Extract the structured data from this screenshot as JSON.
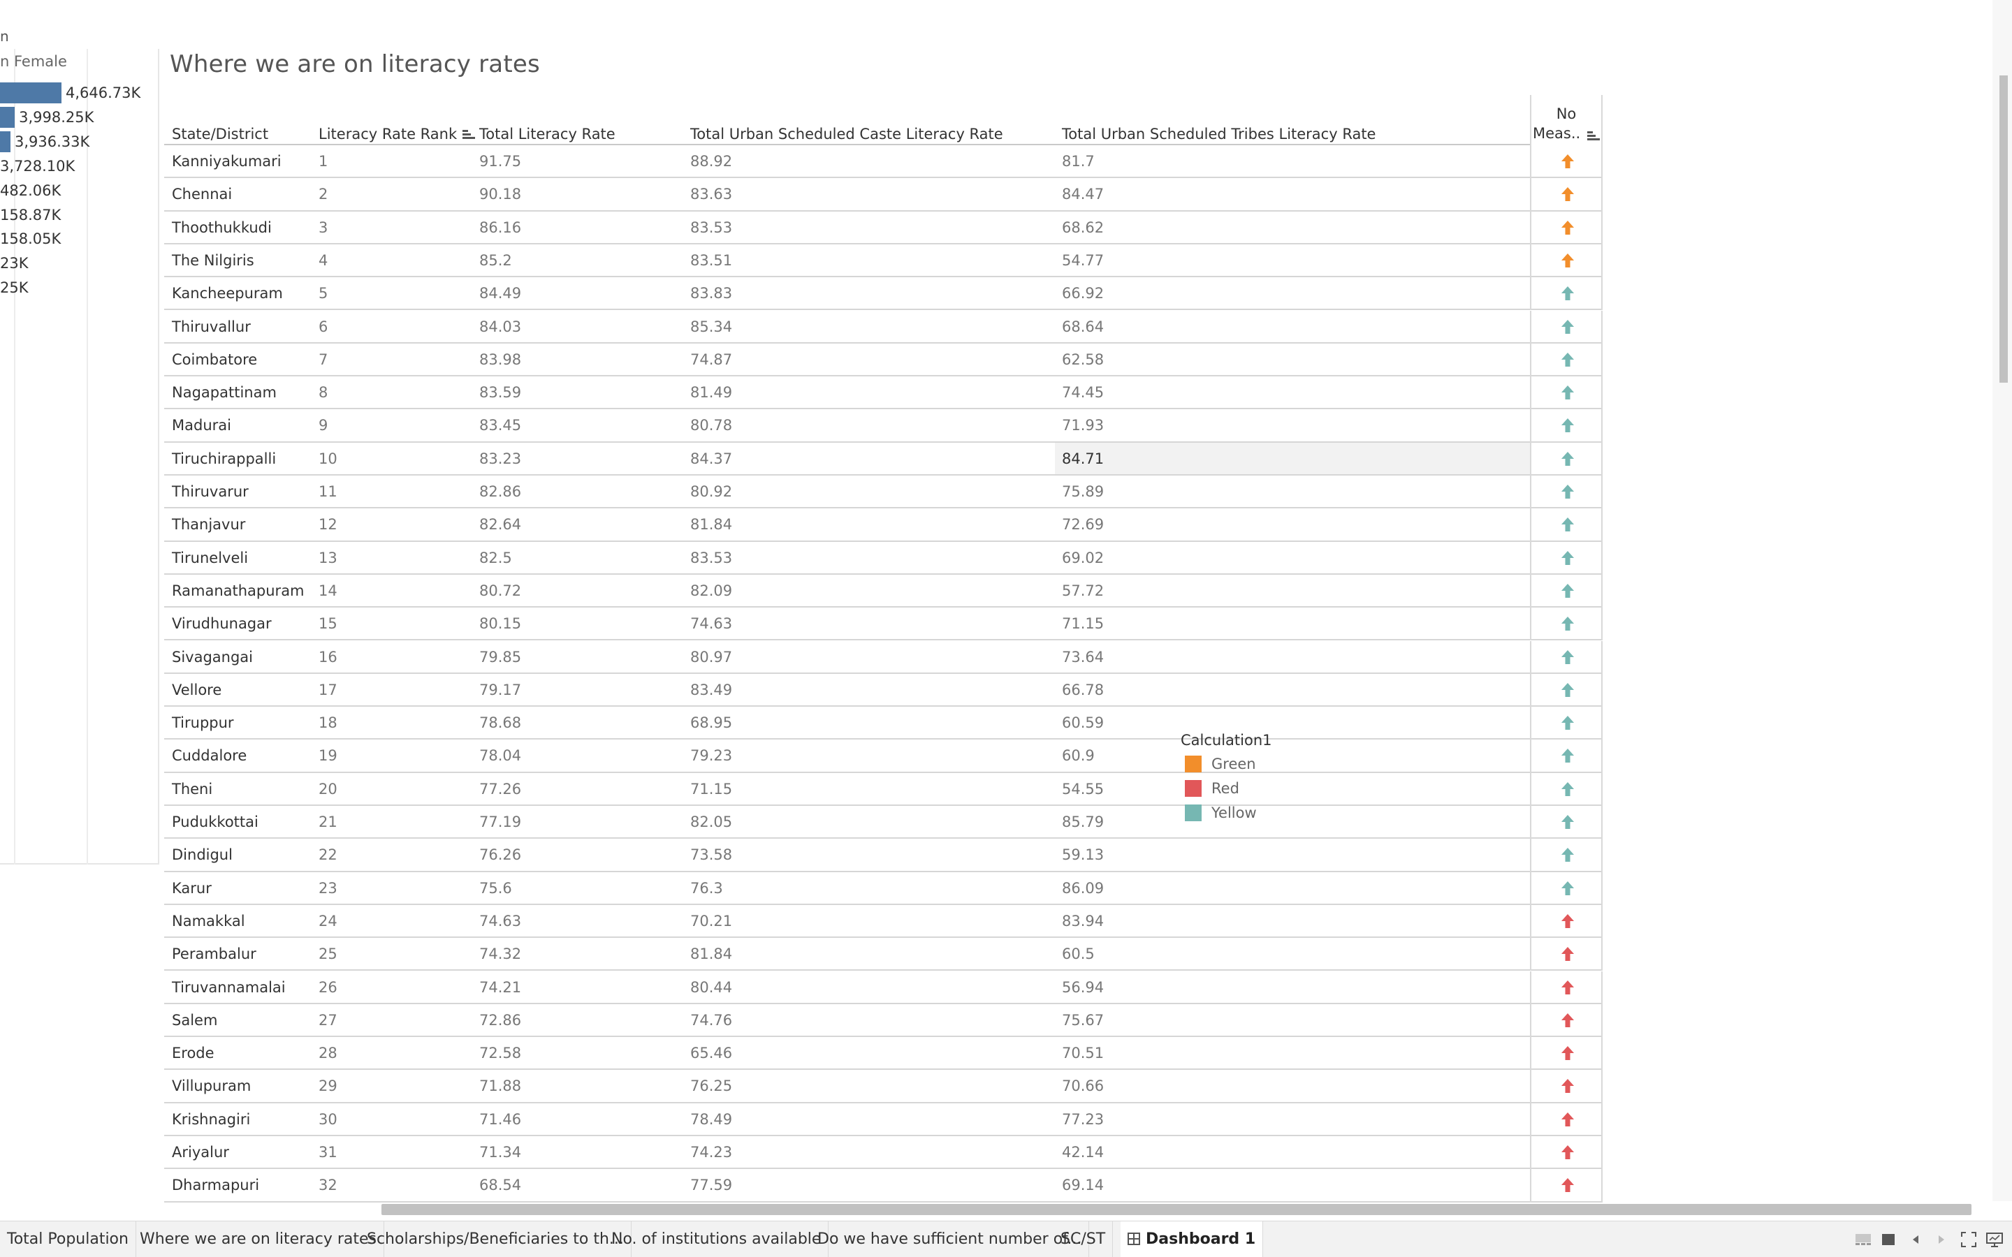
{
  "left_panel": {
    "truncated_title": "n",
    "column_label": "n Female",
    "rows": [
      {
        "label": "4,646.73K",
        "bar_fraction": 1.0
      },
      {
        "label": "3,998.25K",
        "bar_fraction": 0.24
      },
      {
        "label": "3,936.33K",
        "bar_fraction": 0.17
      },
      {
        "label": "3,728.10K",
        "bar_fraction": 0
      },
      {
        "label": "482.06K",
        "bar_fraction": 0
      },
      {
        "label": "158.87K",
        "bar_fraction": 0
      },
      {
        "label": "158.05K",
        "bar_fraction": 0
      },
      {
        "label": "23K",
        "bar_fraction": 0
      },
      {
        "label": "25K",
        "bar_fraction": 0
      }
    ]
  },
  "sheet": {
    "title": "Where we are on literacy rates",
    "columns": {
      "state": "State/District",
      "rank": "Literacy Rate Rank",
      "total": "Total Literacy Rate",
      "sc": "Total Urban Scheduled Caste Literacy Rate",
      "st": "Total Urban Scheduled Tribes Literacy Rate",
      "no_measure_line1": "No",
      "no_measure_line2": "Meas.."
    },
    "rows": [
      {
        "name": "Kanniyakumari",
        "rank": "1",
        "total": "91.75",
        "sc": "88.92",
        "st": "81.7",
        "flag": "Green"
      },
      {
        "name": "Chennai",
        "rank": "2",
        "total": "90.18",
        "sc": "83.63",
        "st": "84.47",
        "flag": "Green"
      },
      {
        "name": "Thoothukkudi",
        "rank": "3",
        "total": "86.16",
        "sc": "83.53",
        "st": "68.62",
        "flag": "Green"
      },
      {
        "name": "The Nilgiris",
        "rank": "4",
        "total": "85.2",
        "sc": "83.51",
        "st": "54.77",
        "flag": "Green"
      },
      {
        "name": "Kancheepuram",
        "rank": "5",
        "total": "84.49",
        "sc": "83.83",
        "st": "66.92",
        "flag": "Yellow"
      },
      {
        "name": "Thiruvallur",
        "rank": "6",
        "total": "84.03",
        "sc": "85.34",
        "st": "68.64",
        "flag": "Yellow"
      },
      {
        "name": "Coimbatore",
        "rank": "7",
        "total": "83.98",
        "sc": "74.87",
        "st": "62.58",
        "flag": "Yellow"
      },
      {
        "name": "Nagapattinam",
        "rank": "8",
        "total": "83.59",
        "sc": "81.49",
        "st": "74.45",
        "flag": "Yellow"
      },
      {
        "name": "Madurai",
        "rank": "9",
        "total": "83.45",
        "sc": "80.78",
        "st": "71.93",
        "flag": "Yellow"
      },
      {
        "name": "Tiruchirappalli",
        "rank": "10",
        "total": "83.23",
        "sc": "84.37",
        "st": "84.71",
        "flag": "Yellow",
        "highlight": true
      },
      {
        "name": "Thiruvarur",
        "rank": "11",
        "total": "82.86",
        "sc": "80.92",
        "st": "75.89",
        "flag": "Yellow"
      },
      {
        "name": "Thanjavur",
        "rank": "12",
        "total": "82.64",
        "sc": "81.84",
        "st": "72.69",
        "flag": "Yellow"
      },
      {
        "name": "Tirunelveli",
        "rank": "13",
        "total": "82.5",
        "sc": "83.53",
        "st": "69.02",
        "flag": "Yellow"
      },
      {
        "name": "Ramanathapuram",
        "rank": "14",
        "total": "80.72",
        "sc": "82.09",
        "st": "57.72",
        "flag": "Yellow"
      },
      {
        "name": "Virudhunagar",
        "rank": "15",
        "total": "80.15",
        "sc": "74.63",
        "st": "71.15",
        "flag": "Yellow"
      },
      {
        "name": "Sivagangai",
        "rank": "16",
        "total": "79.85",
        "sc": "80.97",
        "st": "73.64",
        "flag": "Yellow"
      },
      {
        "name": "Vellore",
        "rank": "17",
        "total": "79.17",
        "sc": "83.49",
        "st": "66.78",
        "flag": "Yellow"
      },
      {
        "name": "Tiruppur",
        "rank": "18",
        "total": "78.68",
        "sc": "68.95",
        "st": "60.59",
        "flag": "Yellow"
      },
      {
        "name": "Cuddalore",
        "rank": "19",
        "total": "78.04",
        "sc": "79.23",
        "st": "60.9",
        "flag": "Yellow"
      },
      {
        "name": "Theni",
        "rank": "20",
        "total": "77.26",
        "sc": "71.15",
        "st": "54.55",
        "flag": "Yellow"
      },
      {
        "name": "Pudukkottai",
        "rank": "21",
        "total": "77.19",
        "sc": "82.05",
        "st": "85.79",
        "flag": "Yellow"
      },
      {
        "name": "Dindigul",
        "rank": "22",
        "total": "76.26",
        "sc": "73.58",
        "st": "59.13",
        "flag": "Yellow"
      },
      {
        "name": "Karur",
        "rank": "23",
        "total": "75.6",
        "sc": "76.3",
        "st": "86.09",
        "flag": "Yellow"
      },
      {
        "name": "Namakkal",
        "rank": "24",
        "total": "74.63",
        "sc": "70.21",
        "st": "83.94",
        "flag": "Red"
      },
      {
        "name": "Perambalur",
        "rank": "25",
        "total": "74.32",
        "sc": "81.84",
        "st": "60.5",
        "flag": "Red"
      },
      {
        "name": "Tiruvannamalai",
        "rank": "26",
        "total": "74.21",
        "sc": "80.44",
        "st": "56.94",
        "flag": "Red"
      },
      {
        "name": "Salem",
        "rank": "27",
        "total": "72.86",
        "sc": "74.76",
        "st": "75.67",
        "flag": "Red"
      },
      {
        "name": "Erode",
        "rank": "28",
        "total": "72.58",
        "sc": "65.46",
        "st": "70.51",
        "flag": "Red"
      },
      {
        "name": "Villupuram",
        "rank": "29",
        "total": "71.88",
        "sc": "76.25",
        "st": "70.66",
        "flag": "Red"
      },
      {
        "name": "Krishnagiri",
        "rank": "30",
        "total": "71.46",
        "sc": "78.49",
        "st": "77.23",
        "flag": "Red"
      },
      {
        "name": "Ariyalur",
        "rank": "31",
        "total": "71.34",
        "sc": "74.23",
        "st": "42.14",
        "flag": "Red"
      },
      {
        "name": "Dharmapuri",
        "rank": "32",
        "total": "68.54",
        "sc": "77.59",
        "st": "69.14",
        "flag": "Red"
      }
    ]
  },
  "legend": {
    "title": "Calculation1",
    "items": [
      {
        "label": "Green",
        "color": "#f28e2b"
      },
      {
        "label": "Red",
        "color": "#e15759"
      },
      {
        "label": "Yellow",
        "color": "#76b7b2"
      }
    ]
  },
  "colors": {
    "Green": "#f28e2b",
    "Red": "#e15759",
    "Yellow": "#76b7b2",
    "bar": "#4e79a7"
  },
  "tabs": [
    {
      "label": "Total Population",
      "active": false
    },
    {
      "label": "Where we are on literacy rates",
      "active": false
    },
    {
      "label": "Scholarships/Beneficiaries to th...",
      "active": false
    },
    {
      "label": "No. of institutions available",
      "active": false
    },
    {
      "label": "Do we have sufficient number of...",
      "active": false
    },
    {
      "label": "SC/ST",
      "active": false
    },
    {
      "label": "Dashboard 1",
      "active": true
    }
  ]
}
